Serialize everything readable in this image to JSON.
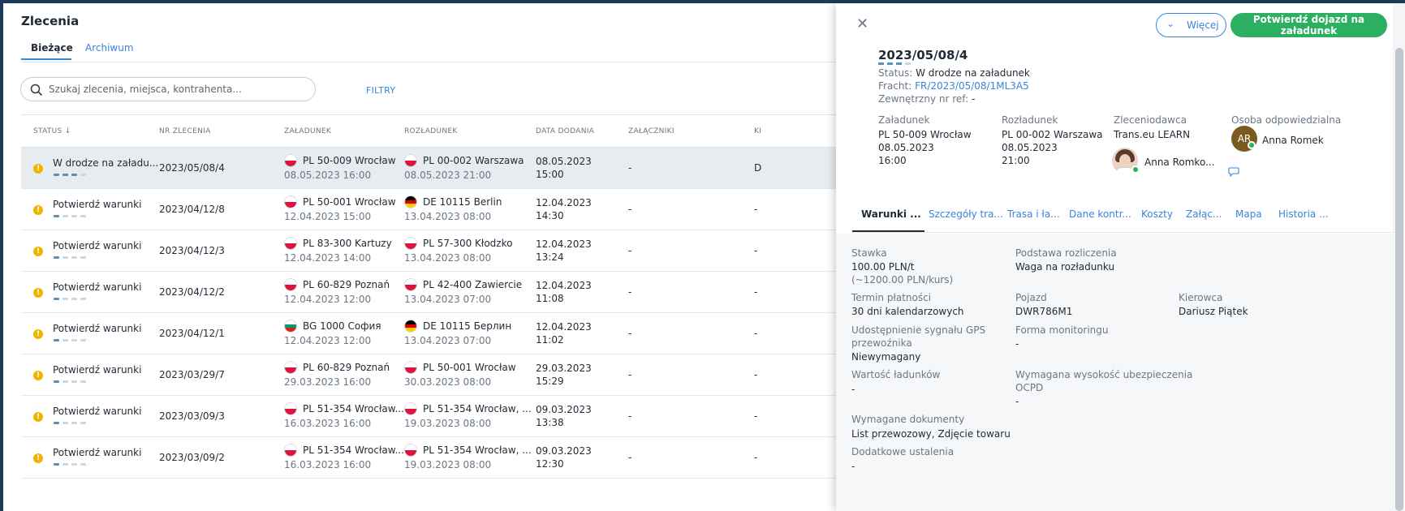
{
  "page": {
    "title": "Zlecenia",
    "tabs": [
      "Bieżące",
      "Archiwum"
    ],
    "search_placeholder": "Szukaj zlecenia, miejsca, kontrahenta...",
    "filters_label": "FILTRY"
  },
  "table": {
    "headers": {
      "status": "STATUS",
      "nr": "NR ZLECENIA",
      "load": "ZAŁADUNEK",
      "unload": "ROZŁADUNEK",
      "date": "DATA DODANIA",
      "att": "ZAŁĄCZNIKI",
      "extra": "KI"
    },
    "rows": [
      {
        "status": "W drodze na załadu...",
        "progress": 3,
        "nr": "2023/05/08/4",
        "load_flag": "PL",
        "load_place": "PL 50-009 Wrocław",
        "load_date": "08.05.2023 16:00",
        "unload_flag": "PL",
        "unload_place": "PL 00-002 Warszawa",
        "unload_date": "08.05.2023 21:00",
        "added_date": "08.05.2023",
        "added_time": "15:00",
        "attachments": "-",
        "extra": "D"
      },
      {
        "status": "Potwierdź warunki",
        "progress": 1,
        "nr": "2023/04/12/8",
        "load_flag": "PL",
        "load_place": "PL 50-001 Wrocław",
        "load_date": "12.04.2023 15:00",
        "unload_flag": "DE",
        "unload_place": "DE 10115 Berlin",
        "unload_date": "13.04.2023 08:00",
        "added_date": "12.04.2023",
        "added_time": "14:30",
        "attachments": "-",
        "extra": "-"
      },
      {
        "status": "Potwierdź warunki",
        "progress": 1,
        "nr": "2023/04/12/3",
        "load_flag": "PL",
        "load_place": "PL 83-300 Kartuzy",
        "load_date": "12.04.2023 14:00",
        "unload_flag": "PL",
        "unload_place": "PL 57-300 Kłodzko",
        "unload_date": "13.04.2023 08:00",
        "added_date": "12.04.2023",
        "added_time": "13:24",
        "attachments": "-",
        "extra": "-"
      },
      {
        "status": "Potwierdź warunki",
        "progress": 1,
        "nr": "2023/04/12/2",
        "load_flag": "PL",
        "load_place": "PL 60-829 Poznań",
        "load_date": "12.04.2023 12:00",
        "unload_flag": "PL",
        "unload_place": "PL 42-400 Zawiercie",
        "unload_date": "13.04.2023 07:00",
        "added_date": "12.04.2023",
        "added_time": "11:08",
        "attachments": "-",
        "extra": "-"
      },
      {
        "status": "Potwierdź warunki",
        "progress": 1,
        "nr": "2023/04/12/1",
        "load_flag": "BG",
        "load_place": "BG 1000 София",
        "load_date": "12.04.2023 12:00",
        "unload_flag": "DE",
        "unload_place": "DE 10115 Берлин",
        "unload_date": "13.04.2023 07:00",
        "added_date": "12.04.2023",
        "added_time": "11:02",
        "attachments": "-",
        "extra": "-"
      },
      {
        "status": "Potwierdź warunki",
        "progress": 1,
        "nr": "2023/03/29/7",
        "load_flag": "PL",
        "load_place": "PL 60-829 Poznań",
        "load_date": "29.03.2023 16:00",
        "unload_flag": "PL",
        "unload_place": "PL 50-001 Wrocław",
        "unload_date": "30.03.2023 08:00",
        "added_date": "29.03.2023",
        "added_time": "15:29",
        "attachments": "-",
        "extra": "-"
      },
      {
        "status": "Potwierdź warunki",
        "progress": 1,
        "nr": "2023/03/09/3",
        "load_flag": "PL",
        "load_place": "PL 51-354 Wrocław...",
        "load_date": "16.03.2023 16:00",
        "unload_flag": "PL",
        "unload_place": "PL 51-354 Wrocław, ...",
        "unload_date": "19.03.2023 08:00",
        "added_date": "09.03.2023",
        "added_time": "13:38",
        "attachments": "-",
        "extra": "-"
      },
      {
        "status": "Potwierdź warunki",
        "progress": 1,
        "nr": "2023/03/09/2",
        "load_flag": "PL",
        "load_place": "PL 51-354 Wrocław...",
        "load_date": "16.03.2023 16:00",
        "unload_flag": "PL",
        "unload_place": "PL 51-354 Wrocław, ...",
        "unload_date": "19.03.2023 08:00",
        "added_date": "09.03.2023",
        "added_time": "12:30",
        "attachments": "-",
        "extra": "-"
      }
    ]
  },
  "panel": {
    "more_label": "Więcej",
    "confirm_label": "Potwierdź dojazd na załadunek",
    "order_no": "2023/05/08/4",
    "status_label": "Status:",
    "status_value": "W drodze na załadunek",
    "freight_label": "Fracht:",
    "freight_value": "FR/2023/05/08/1ML3A5",
    "ext_ref_label": "Zewnętrzny nr ref:",
    "ext_ref_value": "-",
    "loading": {
      "label": "Załadunek",
      "place": "PL 50-009 Wrocław",
      "date": "08.05.2023",
      "time": "16:00"
    },
    "unloading": {
      "label": "Rozładunek",
      "place": "PL 00-002 Warszawa",
      "date": "08.05.2023",
      "time": "21:00"
    },
    "principal": {
      "label": "Zleceniodawca",
      "company": "Trans.eu LEARN",
      "person": "Anna Romko..."
    },
    "responsible": {
      "label": "Osoba odpowiedzialna",
      "initials": "AR",
      "name": "Anna Romek"
    },
    "tabs": [
      "Warunki ...",
      "Szczegóły tra...",
      "Trasa i ła...",
      "Dane kontr...",
      "Koszty",
      "Załąc...",
      "Mapa",
      "Historia ..."
    ],
    "fields": {
      "rate_label": "Stawka",
      "rate_value": "100.00 PLN/t",
      "rate_approx": "(~1200.00 PLN/kurs)",
      "basis_label": "Podstawa rozliczenia",
      "basis_value": "Waga na rozładunku",
      "payment_label": "Termin płatności",
      "payment_value": "30 dni kalendarzowych",
      "vehicle_label": "Pojazd",
      "vehicle_value": "DWR786M1",
      "driver_label": "Kierowca",
      "driver_value": "Dariusz Piątek",
      "gps_label_1": "Udostępnienie sygnału GPS",
      "gps_label_2": "przewoźnika",
      "gps_value": "Niewymagany",
      "monitoring_label": "Forma monitoringu",
      "monitoring_value": "-",
      "cargo_value_label": "Wartość ładunków",
      "cargo_value_value": "-",
      "insurance_label": "Wymagana wysokość ubezpieczenia",
      "insurance_label_2": "OCPD",
      "insurance_value": "-",
      "docs_label": "Wymagane dokumenty",
      "docs_value": "List przewozowy, Zdjęcie towaru",
      "extra_label": "Dodatkowe ustalenia",
      "extra_value": "-"
    }
  },
  "colors": {
    "accent": "#3a84d8",
    "confirm": "#2daf62",
    "warning": "#f0b400",
    "frame": "#1d3a5c"
  },
  "icons": {
    "search": "search-icon",
    "close": "close-icon",
    "chevron": "chevron-down-icon",
    "sort": "sort-arrow-icon",
    "chat": "chat-bubble-icon",
    "warning": "warning-icon"
  }
}
